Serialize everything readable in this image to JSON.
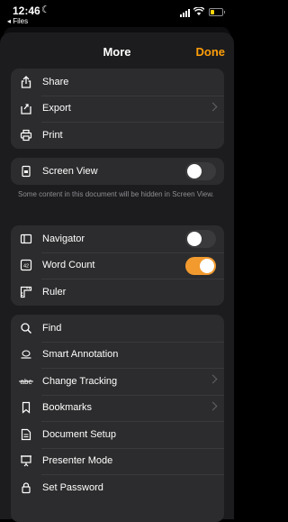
{
  "status": {
    "time": "12:46",
    "back_label": "◂ Files"
  },
  "header": {
    "title": "More",
    "done_label": "Done"
  },
  "group1": [
    {
      "label": "Share",
      "icon": "share-icon"
    },
    {
      "label": "Export",
      "icon": "export-icon",
      "chevron": true
    },
    {
      "label": "Print",
      "icon": "print-icon"
    }
  ],
  "screen_view": {
    "label": "Screen View",
    "on": false,
    "note": "Some content in this document will be hidden in Screen View."
  },
  "group3": [
    {
      "label": "Navigator",
      "icon": "navigator-icon",
      "toggle": false
    },
    {
      "label": "Word Count",
      "icon": "word-count-icon",
      "toggle": true
    },
    {
      "label": "Ruler",
      "icon": "ruler-icon"
    }
  ],
  "group4": [
    {
      "label": "Find",
      "icon": "search-icon"
    },
    {
      "label": "Smart Annotation",
      "icon": "smart-annotation-icon"
    },
    {
      "label": "Change Tracking",
      "icon": "change-tracking-icon",
      "chevron": true
    },
    {
      "label": "Bookmarks",
      "icon": "bookmark-icon",
      "chevron": true
    },
    {
      "label": "Document Setup",
      "icon": "document-setup-icon"
    },
    {
      "label": "Presenter Mode",
      "icon": "presenter-mode-icon"
    },
    {
      "label": "Set Password",
      "icon": "lock-icon"
    }
  ],
  "colors": {
    "accent": "#ff9f0a",
    "toggle_on": "#f29a2e",
    "sheet": "#1c1c1e",
    "row": "#2c2c2e"
  }
}
